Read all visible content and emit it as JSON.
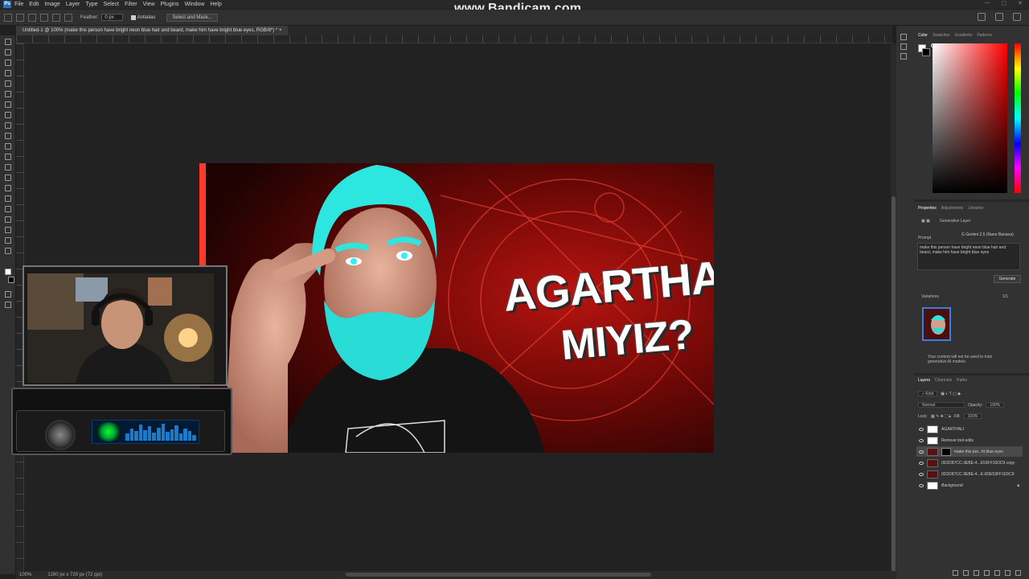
{
  "watermark": "www.Bandicam.com",
  "app": {
    "logo": "Ps"
  },
  "menu": [
    "File",
    "Edit",
    "Image",
    "Layer",
    "Type",
    "Select",
    "Filter",
    "View",
    "Plugins",
    "Window",
    "Help"
  ],
  "options": {
    "feather_label": "Feather:",
    "feather_value": "0 px",
    "antialias_label": "Antialias",
    "select_mask_label": "Select and Mask..."
  },
  "document": {
    "tab_title": "Untitled-1 @ 100% (make this person have bright neon blue hair and beard, make him have bright blue eyes, RGB/8*) *"
  },
  "thumbnail": {
    "line1": "AGARTHALI",
    "line2": "MIYIZ?"
  },
  "status": {
    "zoom": "100%",
    "size": "1280 px x 720 px (72 ppi)"
  },
  "panels": {
    "color_tabs": [
      "Color",
      "Swatches",
      "Gradients",
      "Patterns"
    ],
    "props_tabs": [
      "Properties",
      "Adjustments",
      "Libraries"
    ],
    "layer_type": "Generative Layer",
    "prompt_label": "Prompt",
    "model": "Gemini 2.5 (Nano Banana)",
    "prompt_text": "make this person have bright neon blue hair and beard, make him have bright blue eyes",
    "generate_label": "Generate",
    "variations_label": "Variations",
    "variations_count": "1/1",
    "disclaimer": "Your content will not be used to train generative AI models.",
    "layers_tabs": [
      "Layers",
      "Channels",
      "Paths"
    ],
    "kind_label": "Kind",
    "blend_mode": "Normal",
    "opacity_label": "Opacity:",
    "opacity_value": "100%",
    "lock_label": "Lock:",
    "fill_label": "Fill:",
    "fill_value": "100%"
  },
  "layers": [
    {
      "name": "AGARTHALI"
    },
    {
      "name": "Remove tool edits"
    },
    {
      "name": "make this per...ht blue eyes"
    },
    {
      "name": "0D2D87CC-3EBE-4...E53FF16DC9 copy"
    },
    {
      "name": "0D2D87CC-3EBE-4...E-6DE53FF16DC9"
    },
    {
      "name": "Background"
    }
  ]
}
